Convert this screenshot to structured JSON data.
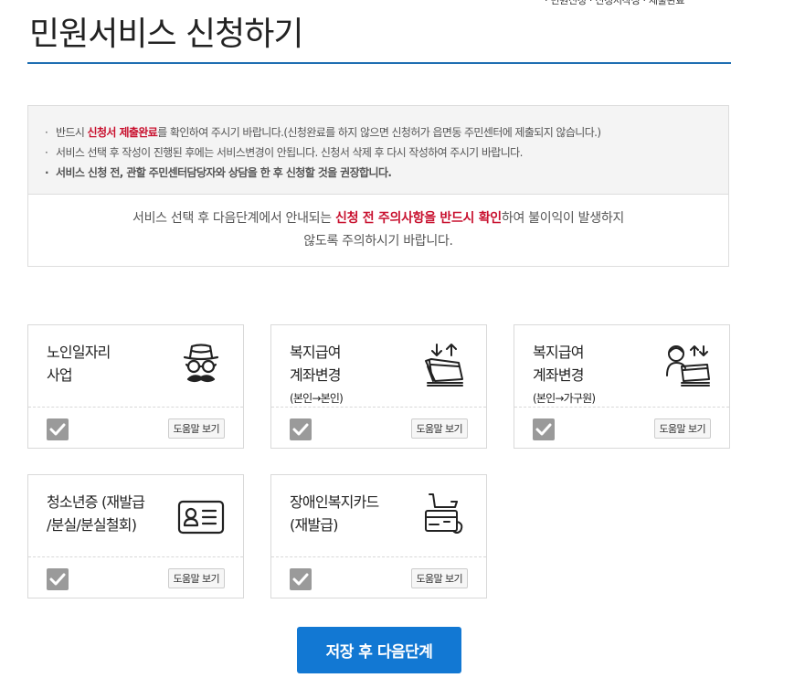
{
  "page": {
    "title": "민원서비스 신청하기",
    "top_crop_text": "· 민원신청 · 신청서작성 · 제출완료"
  },
  "notice": {
    "line1": {
      "pre": "반드시 ",
      "highlight": "신청서 제출완료",
      "post": "를 확인하여 주시기 바랍니다.(신청완료를 하지 않으면 신청허가 읍면동 주민센터에 제출되지 않습니다.)"
    },
    "line2": "서비스 선택 후 작성이 진행된 후에는 서비스변경이 안됩니다. 신청서 삭제 후 다시 작성하여 주시기 바랍니다.",
    "line3": "서비스 신청 전, 관할 주민센터담당자와 상담을 한 후 신청할 것을 권장합니다.",
    "bottom": {
      "pre": "서비스 선택 후 다음단계에서 안내되는 ",
      "highlight": "신청 전 주의사항을 반드시 확인",
      "post": "하여 불이익이 발생하지",
      "line2": "않도록 주의하시기 바랍니다."
    }
  },
  "services": [
    {
      "title": "노인일자리\n사업",
      "sub": "",
      "icon": "elder-disguise-icon",
      "help": "도움말 보기",
      "checked": true
    },
    {
      "title": "복지급여\n계좌변경",
      "sub": "(본인→본인)",
      "icon": "bankbook-transfer-icon",
      "help": "도움말 보기",
      "checked": true
    },
    {
      "title": "복지급여\n계좌변경",
      "sub": "(본인→가구원)",
      "icon": "person-bankbook-icon",
      "help": "도움말 보기",
      "checked": true
    },
    {
      "title": "청소년증 (재발급\n/분실/분실철회)",
      "sub": "",
      "icon": "id-card-icon",
      "help": "도움말 보기",
      "checked": true
    },
    {
      "title": "장애인복지카드\n(재발급)",
      "sub": "",
      "icon": "wheelchair-card-icon",
      "help": "도움말 보기",
      "checked": true
    }
  ],
  "actions": {
    "save_next": "저장 후 다음단계"
  },
  "colors": {
    "accent": "#1278d3",
    "title_rule": "#1f6fb2",
    "highlight": "#c8102e",
    "checkbox": "#9a9a9a"
  }
}
